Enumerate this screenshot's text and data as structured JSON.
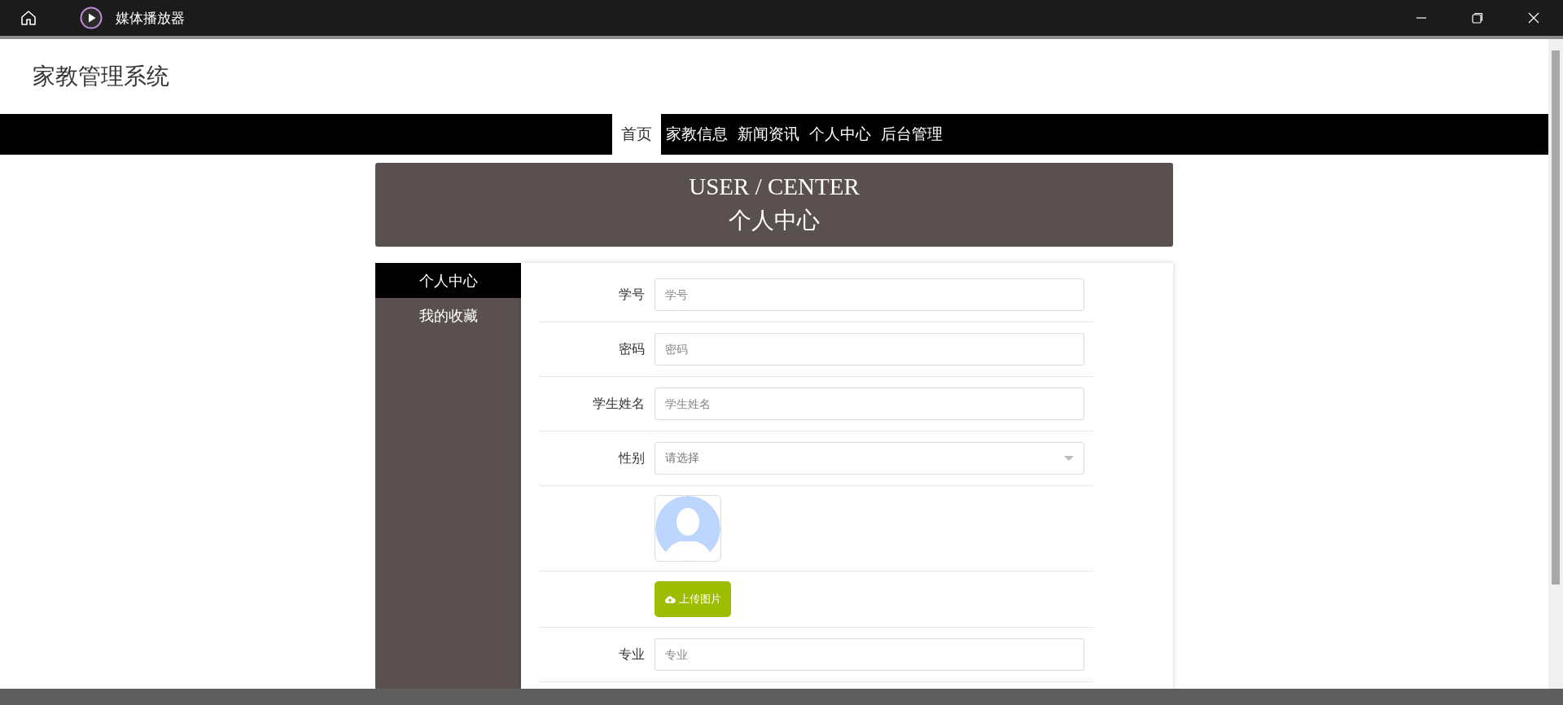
{
  "window": {
    "title": "媒体播放器"
  },
  "site": {
    "title": "家教管理系统"
  },
  "nav": [
    {
      "label": "首页",
      "selected": true
    },
    {
      "label": "家教信息",
      "selected": false
    },
    {
      "label": "新闻资讯",
      "selected": false
    },
    {
      "label": "个人中心",
      "selected": false
    },
    {
      "label": "后台管理",
      "selected": false
    }
  ],
  "banner": {
    "title_en": "USER / CENTER",
    "title_zh": "个人中心"
  },
  "sidebar": [
    {
      "label": "个人中心",
      "selected": true
    },
    {
      "label": "我的收藏",
      "selected": false
    }
  ],
  "form": [
    {
      "kind": "text",
      "label": "学号",
      "placeholder": "学号"
    },
    {
      "kind": "text",
      "label": "密码",
      "placeholder": "密码"
    },
    {
      "kind": "text",
      "label": "学生姓名",
      "placeholder": "学生姓名"
    },
    {
      "kind": "select",
      "label": "性别",
      "placeholder": "请选择"
    },
    {
      "kind": "avatar"
    },
    {
      "kind": "upload",
      "button": "上传图片"
    },
    {
      "kind": "text",
      "label": "专业",
      "placeholder": "专业"
    }
  ]
}
